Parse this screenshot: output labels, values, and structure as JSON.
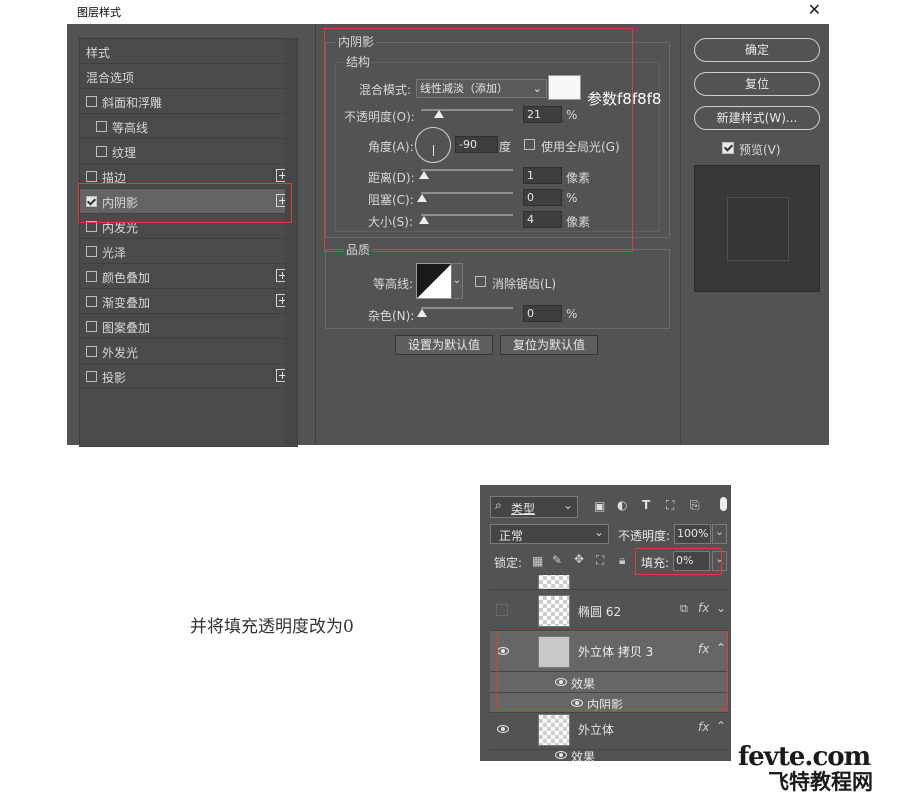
{
  "dialog": {
    "title": "图层样式",
    "close": "✕",
    "styles_header": "样式",
    "blend_options": "混合选项",
    "left_items": [
      {
        "label": "斜面和浮雕",
        "checked": false,
        "plus": false
      },
      {
        "label": "等高线",
        "checked": false,
        "plus": false,
        "indent": true
      },
      {
        "label": "纹理",
        "checked": false,
        "plus": false,
        "indent": true
      },
      {
        "label": "描边",
        "checked": false,
        "plus": true
      },
      {
        "label": "内阴影",
        "checked": true,
        "plus": true,
        "selected": true
      },
      {
        "label": "内发光",
        "checked": false,
        "plus": false
      },
      {
        "label": "光泽",
        "checked": false,
        "plus": false
      },
      {
        "label": "颜色叠加",
        "checked": false,
        "plus": true
      },
      {
        "label": "渐变叠加",
        "checked": false,
        "plus": true
      },
      {
        "label": "图案叠加",
        "checked": false,
        "plus": false
      },
      {
        "label": "外发光",
        "checked": false,
        "plus": false
      },
      {
        "label": "投影",
        "checked": false,
        "plus": true
      }
    ],
    "section_title": "内阴影",
    "structure_title": "结构",
    "blend_mode_label": "混合模式:",
    "blend_mode_value": "线性减淡（添加）",
    "color_swatch": "#f8f8f8",
    "param_note": "参数f8f8f8",
    "opacity_label": "不透明度(O):",
    "opacity_value": "21",
    "opacity_unit": "%",
    "angle_label": "角度(A):",
    "angle_value": "-90",
    "angle_unit": "度",
    "global_light_label": "使用全局光(G)",
    "distance_label": "距离(D):",
    "distance_value": "1",
    "distance_unit": "像素",
    "choke_label": "阻塞(C):",
    "choke_value": "0",
    "choke_unit": "%",
    "size_label": "大小(S):",
    "size_value": "4",
    "size_unit": "像素",
    "quality_title": "品质",
    "contour_label": "等高线:",
    "antialias_label": "消除锯齿(L)",
    "noise_label": "杂色(N):",
    "noise_value": "0",
    "noise_unit": "%",
    "make_default": "设置为默认值",
    "reset_default": "复位为默认值",
    "ok": "确定",
    "reset": "复位",
    "new_style": "新建样式(W)...",
    "preview_label": "预览(V)"
  },
  "caption": "并将填充透明度改为0",
  "layers": {
    "filter_kind": "类型",
    "blend_mode": "正常",
    "opacity_label": "不透明度:",
    "opacity_value": "100%",
    "lock_label": "锁定:",
    "fill_label": "填充:",
    "fill_value": "0%",
    "rows": [
      {
        "name": "椭圆 62",
        "visible": false
      },
      {
        "name": "外立体 拷贝 3",
        "visible": true,
        "effects": "效果",
        "effect_item": "内阴影"
      },
      {
        "name": "外立体",
        "visible": true,
        "effects": "效果"
      }
    ],
    "fx": "fx"
  },
  "watermark": {
    "line1": "fevte.com",
    "line2": "飞特教程网"
  }
}
